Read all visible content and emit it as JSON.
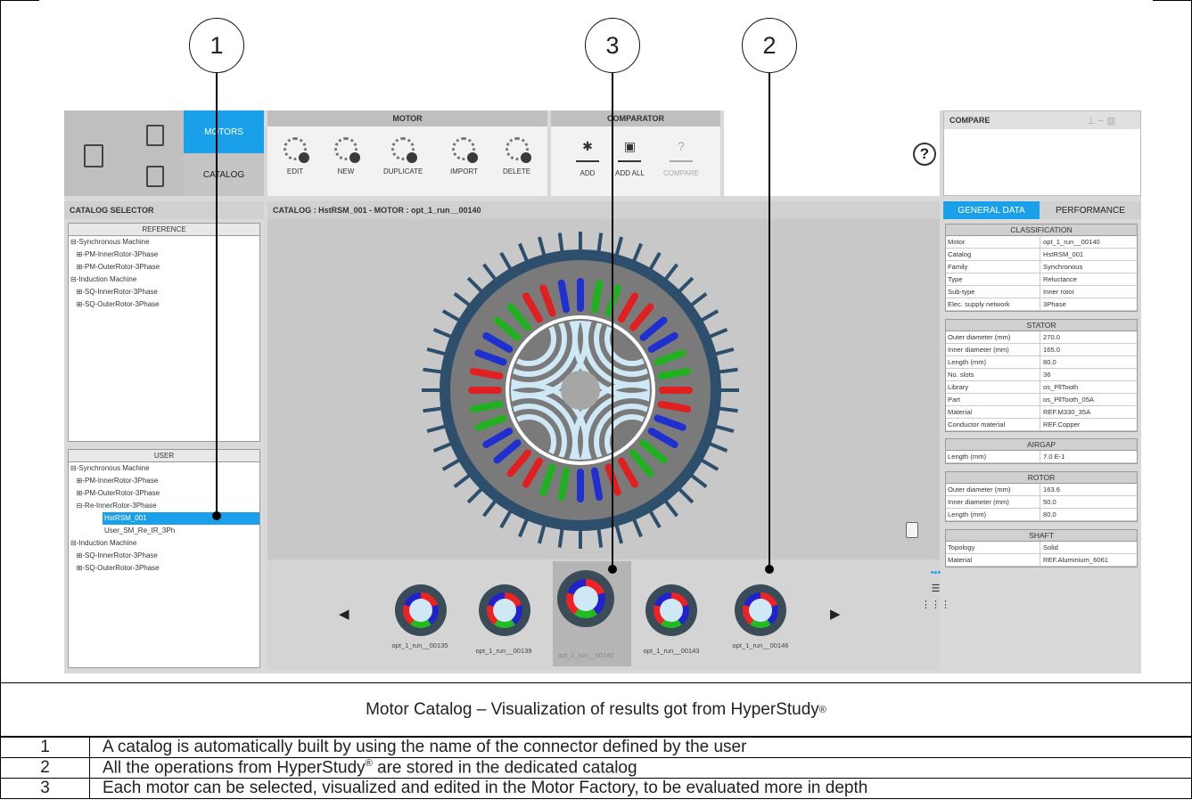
{
  "callouts": [
    "1",
    "3",
    "2"
  ],
  "app": {
    "left_buttons": {
      "motors": "MOTORS",
      "catalog": "CATALOG"
    },
    "motor_group": {
      "title": "MOTOR",
      "buttons": [
        "EDIT",
        "NEW",
        "DUPLICATE",
        "IMPORT",
        "DELETE"
      ]
    },
    "comparator_group": {
      "title": "COMPARATOR",
      "buttons": [
        "ADD",
        "ADD ALL",
        "COMPARE"
      ]
    },
    "help": "?",
    "compare_panel": {
      "title": "COMPARE"
    },
    "catalog_selector": {
      "title": "CATALOG SELECTOR",
      "reference": {
        "title": "REFERENCE",
        "items": [
          "⊟-Synchronous Machine",
          "   ⊞-PM-InnerRotor-3Phase",
          "   ⊞-PM-OuterRotor-3Phase",
          "⊟-Induction Machine",
          "   ⊞-SQ-InnerRotor-3Phase",
          "   ⊞-SQ-OuterRotor-3Phase"
        ]
      },
      "user": {
        "title": "USER",
        "items": [
          "⊟-Synchronous Machine",
          "   ⊞-PM-InnerRotor-3Phase",
          "   ⊞-PM-OuterRotor-3Phase",
          "   ⊟-Re-InnerRotor-3Phase",
          "HstRSM_001",
          "User_SM_Re_IR_3Ph",
          "⊟-Induction Machine",
          "   ⊞-SQ-InnerRotor-3Phase",
          "   ⊞-SQ-OuterRotor-3Phase"
        ]
      }
    },
    "view_header": "CATALOG : HstRSM_001   -   MOTOR : opt_1_run__00140",
    "tabs": {
      "general": "GENERAL DATA",
      "performance": "PERFORMANCE"
    },
    "thumbnails": [
      "opt_1_run__00135",
      "opt_1_run__00139",
      "opt_1_run__00140",
      "opt_1_run__00143",
      "opt_1_run__00146"
    ],
    "nav": {
      "prev": "◀",
      "next": "▶"
    },
    "data_groups": {
      "classification": {
        "title": "CLASSIFICATION",
        "rows": [
          [
            "Motor",
            "opt_1_run__00140"
          ],
          [
            "Catalog",
            "HstRSM_001"
          ],
          [
            "Family",
            "Synchronous"
          ],
          [
            "Type",
            "Reluctance"
          ],
          [
            "Sub-type",
            "Inner rotor"
          ],
          [
            "Elec. supply network",
            "3Phase"
          ]
        ]
      },
      "stator": {
        "title": "STATOR",
        "rows": [
          [
            "Outer diameter (mm)",
            "270.0"
          ],
          [
            "Inner diameter (mm)",
            "165.0"
          ],
          [
            "Length (mm)",
            "80.0"
          ],
          [
            "No. slots",
            "36"
          ],
          [
            "Library",
            "os_PllTooth"
          ],
          [
            "Part",
            "os_PllTooth_05A"
          ],
          [
            "Material",
            "REF.M330_35A"
          ],
          [
            "Conductor material",
            "REF.Copper"
          ]
        ]
      },
      "airgap": {
        "title": "AIRGAP",
        "rows": [
          [
            "Length (mm)",
            "7.0 E-1"
          ]
        ]
      },
      "rotor": {
        "title": "ROTOR",
        "rows": [
          [
            "Outer diameter (mm)",
            "163.6"
          ],
          [
            "Inner diameter (mm)",
            "50.0"
          ],
          [
            "Length (mm)",
            "80.0"
          ]
        ]
      },
      "shaft": {
        "title": "SHAFT",
        "rows": [
          [
            "Topology",
            "Solid"
          ],
          [
            "Material",
            "REF.Aluminium_6061"
          ]
        ]
      }
    }
  },
  "caption": {
    "text": "Motor Catalog – Visualization of results got from HyperStudy",
    "mark": "®"
  },
  "notes": [
    {
      "n": "1",
      "text": "A catalog is automatically built by using the name of the connector defined by the user"
    },
    {
      "n": "2",
      "text_a": "All the operations from HyperStudy",
      "mark": "®",
      "text_b": " are stored in the dedicated catalog"
    },
    {
      "n": "3",
      "text": "Each motor can be selected, visualized and edited in the Motor Factory, to be evaluated more in depth"
    }
  ],
  "colors": {
    "accent": "#1aa0e8",
    "stator": "#3b4c59",
    "rotor_slot": "#cfe8f5"
  }
}
